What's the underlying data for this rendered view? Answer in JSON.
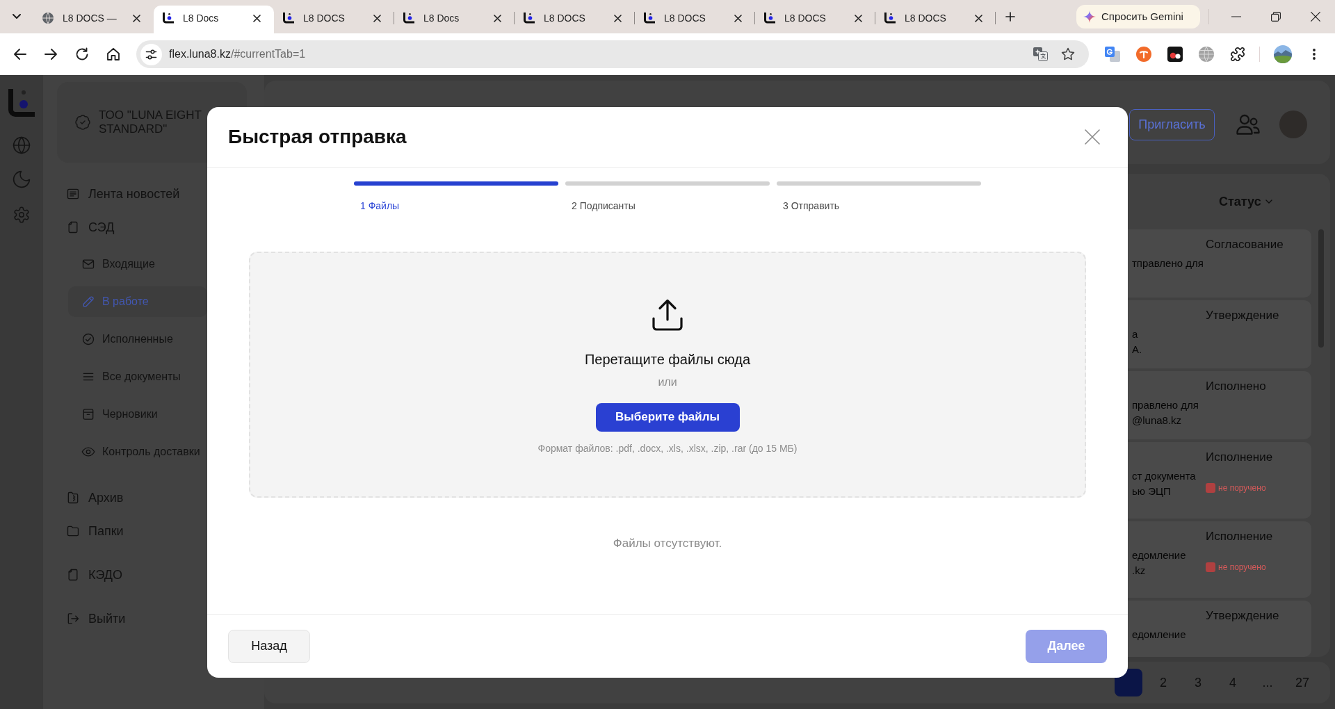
{
  "browser": {
    "tabs": [
      {
        "kind": "site",
        "title": "L8 DOCS —",
        "selected": false
      },
      {
        "kind": "app",
        "title": "L8 Docs",
        "selected": true
      },
      {
        "kind": "app",
        "title": "L8 DOCS",
        "selected": false
      },
      {
        "kind": "app",
        "title": "L8 Docs",
        "selected": false
      },
      {
        "kind": "app",
        "title": "L8 DOCS",
        "selected": false
      },
      {
        "kind": "app",
        "title": "L8 DOCS",
        "selected": false
      },
      {
        "kind": "app",
        "title": "L8 DOCS",
        "selected": false
      },
      {
        "kind": "app",
        "title": "L8 DOCS",
        "selected": false
      }
    ],
    "gemini_button": "Спросить Gemini",
    "address": {
      "host": "flex.luna8.kz",
      "path": "/#currentTab=1"
    }
  },
  "sidebar": {
    "org_name": "ТОО \"LUNA EIGHT STANDARD\"",
    "nav_sections": [
      {
        "items": [
          {
            "label": "Лента новостей",
            "selected": false
          },
          {
            "label": "СЭД",
            "selected": false,
            "children": [
              {
                "label": "Входящие",
                "selected": false
              },
              {
                "label": "В работе",
                "selected": true
              },
              {
                "label": "Исполненные",
                "selected": false
              },
              {
                "label": "Все документы",
                "selected": false
              },
              {
                "label": "Черновики",
                "selected": false
              },
              {
                "label": "Контроль доставки",
                "selected": false
              }
            ]
          }
        ]
      },
      {
        "items": [
          {
            "label": "Архив",
            "selected": false
          },
          {
            "label": "Папки",
            "selected": false
          }
        ]
      },
      {
        "items": [
          {
            "label": "КЭДО",
            "selected": false
          }
        ]
      },
      {
        "items": [
          {
            "label": "Выйти",
            "selected": false
          }
        ]
      }
    ]
  },
  "header": {
    "invite_button": "Пригласить"
  },
  "table": {
    "columns": [
      {
        "label": "Статус"
      }
    ],
    "rows": [
      {
        "column_1": [
          "тправлено для"
        ],
        "status": "Согласование"
      },
      {
        "column_1": [
          "а",
          "А."
        ],
        "status": "Утверждение"
      },
      {
        "column_1": [
          "правлено для",
          "@luna8.kz"
        ],
        "status": "Исполнено"
      },
      {
        "column_1": [
          "ст документа",
          "ью ЭЦП"
        ],
        "status": "Исполнение",
        "badge": "не поручено"
      },
      {
        "column_1": [
          "едомление",
          ".kz"
        ],
        "status": "Исполнение",
        "badge": "не поручено"
      },
      {
        "column_1": [
          "едомление"
        ],
        "status": "Утверждение"
      }
    ]
  },
  "pagination": {
    "pages": [
      {
        "selected": true
      },
      {
        "label": "2",
        "selected": false
      },
      {
        "label": "3",
        "selected": false
      },
      {
        "label": "4",
        "selected": false
      },
      {
        "label": "...",
        "selected": false
      },
      {
        "label": "27",
        "selected": false
      }
    ]
  },
  "modal": {
    "title": "Быстрая отправка",
    "steps": [
      {
        "label": "1 Файлы",
        "selected": true
      },
      {
        "label": "2 Подписанты",
        "selected": false
      },
      {
        "label": "3 Отправить",
        "selected": false
      }
    ],
    "dropzone": {
      "prompt": "Перетащите файлы сюда",
      "separator": "или",
      "button": "Выберите файлы",
      "hint": "Формат файлов: .pdf, .docx, .xls, .xlsx, .zip, .rar (до 15 МБ)"
    },
    "empty_message": "Файлы отсутствуют.",
    "buttons": [
      {
        "kind": "back",
        "label": "Назад",
        "disabled": false
      },
      {
        "kind": "next",
        "label": "Далее",
        "disabled": true
      }
    ]
  }
}
